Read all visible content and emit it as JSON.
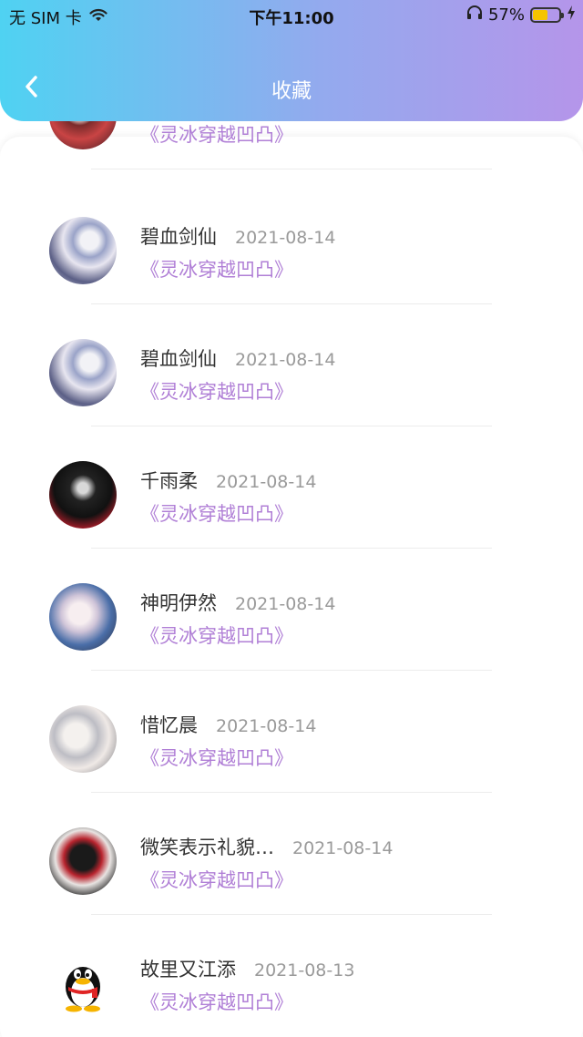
{
  "status_bar": {
    "carrier": "无 SIM 卡",
    "time": "下午11:00",
    "battery_percent": "57%",
    "battery_level": 0.57
  },
  "nav": {
    "title": "收藏",
    "back_icon": "chevron-left-icon"
  },
  "colors": {
    "header_gradient": [
      "#4fd2f2",
      "#93aaee",
      "#b595ea"
    ],
    "book_title": "#b07fd6",
    "date_text": "#9a9a9a"
  },
  "favorites": [
    {
      "name": "",
      "date": "",
      "book": "《灵冰穿越凹凸》",
      "avatar": "anime-girl-red"
    },
    {
      "name": "碧血剑仙",
      "date": "2021-08-14",
      "book": "《灵冰穿越凹凸》",
      "avatar": "anime-white-hair"
    },
    {
      "name": "碧血剑仙",
      "date": "2021-08-14",
      "book": "《灵冰穿越凹凸》",
      "avatar": "anime-white-hair"
    },
    {
      "name": "千雨柔",
      "date": "2021-08-14",
      "book": "《灵冰穿越凹凸》",
      "avatar": "anime-dark-sword"
    },
    {
      "name": "神明伊然",
      "date": "2021-08-14",
      "book": "《灵冰穿越凹凸》",
      "avatar": "anime-flowers"
    },
    {
      "name": "惜忆晨",
      "date": "2021-08-14",
      "book": "《灵冰穿越凹凸》",
      "avatar": "anime-silver-boy"
    },
    {
      "name": "微笑表示礼貌…",
      "date": "2021-08-14",
      "book": "《灵冰穿越凹凸》",
      "avatar": "anime-dark-figure"
    },
    {
      "name": "故里又江添",
      "date": "2021-08-13",
      "book": "《灵冰穿越凹凸》",
      "avatar": "qq-penguin"
    }
  ]
}
